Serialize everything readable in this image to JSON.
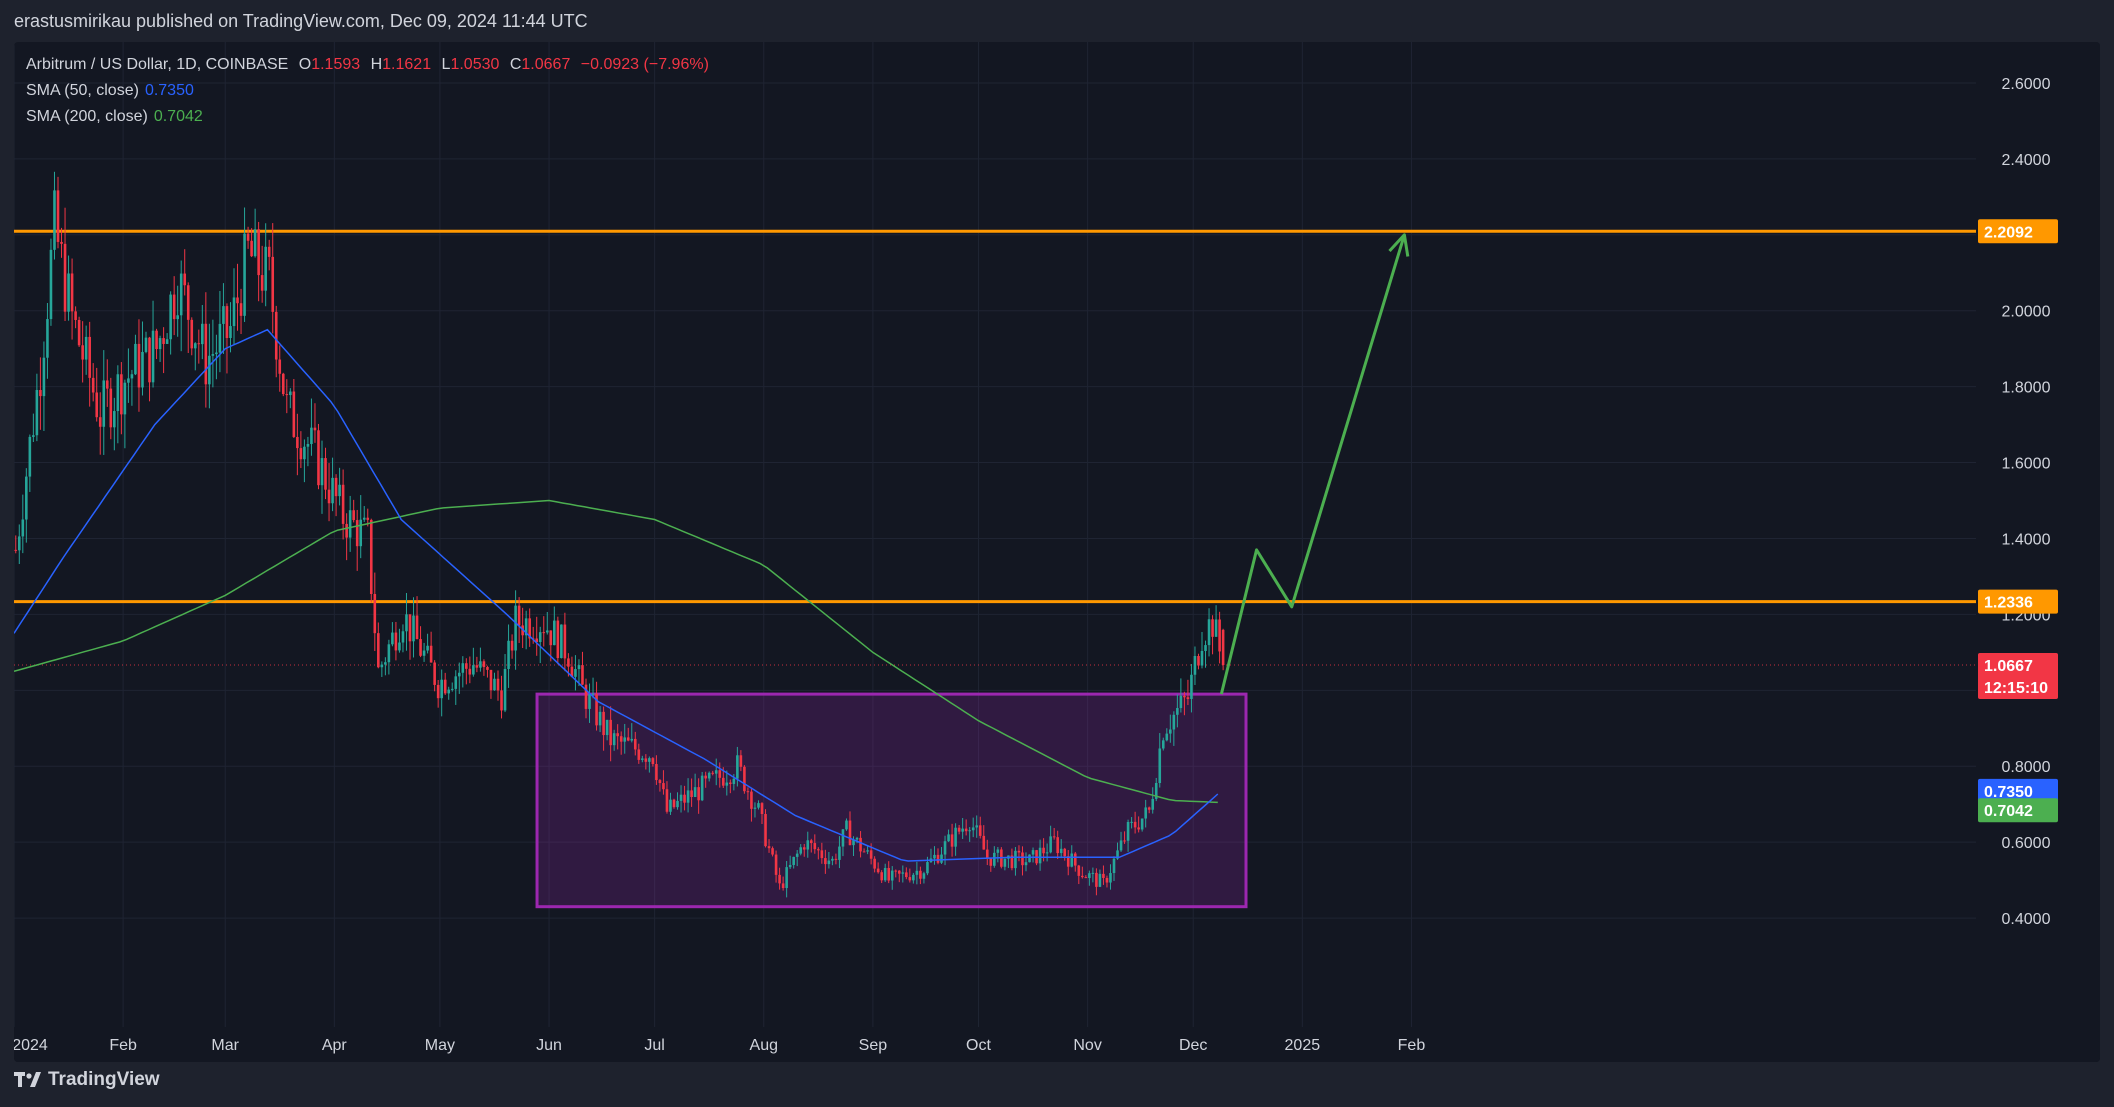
{
  "header": {
    "published": "erastusmirikau published on TradingView.com, Dec 09, 2024 11:44 UTC"
  },
  "legend": {
    "symbol": "Arbitrum / US Dollar, 1D, COINBASE",
    "o_label": "O",
    "o": "1.1593",
    "h_label": "H",
    "h": "1.1621",
    "l_label": "L",
    "l": "1.0530",
    "c_label": "C",
    "c": "1.0667",
    "change": "−0.0923 (−7.96%)",
    "sma50_label": "SMA (50, close)",
    "sma50": "0.7350",
    "sma200_label": "SMA (200, close)",
    "sma200": "0.7042"
  },
  "footer": {
    "brand": "TradingView"
  },
  "colors": {
    "up": "#26a69a",
    "down": "#f23645",
    "sma50": "#2962ff",
    "sma200": "#4caf50",
    "level": "#ff9800",
    "box": "#9c27b0",
    "projection": "#4caf50"
  },
  "chart_data": {
    "type": "candlestick",
    "ylim": [
      0.2,
      2.7
    ],
    "y_ticks": [
      "2.6000",
      "2.4000",
      "2.0000",
      "1.8000",
      "1.6000",
      "1.4000",
      "1.2000",
      "0.8000",
      "0.6000",
      "0.4000"
    ],
    "x_ticks": [
      "2024",
      "Feb",
      "Mar",
      "Apr",
      "May",
      "Jun",
      "Jul",
      "Aug",
      "Sep",
      "Oct",
      "Nov",
      "Dec",
      "2025",
      "Feb"
    ],
    "levels": [
      {
        "value": 2.2092,
        "label": "2.2092"
      },
      {
        "value": 1.2336,
        "label": "1.2336"
      }
    ],
    "last_price": {
      "value": 1.0667,
      "label": "1.0667",
      "countdown": "12:15:10"
    },
    "sma50_badge": {
      "value": 0.735,
      "label": "0.7350"
    },
    "sma200_badge": {
      "value": 0.7042,
      "label": "0.7042"
    },
    "consolidation_box": {
      "from": "2024-06-01",
      "to": "2024-12-16",
      "low": 0.43,
      "high": 0.99
    },
    "projection_path": [
      {
        "date": "2024-12-09",
        "value": 0.99
      },
      {
        "date": "2024-12-19",
        "value": 1.37
      },
      {
        "date": "2024-12-29",
        "value": 1.22
      },
      {
        "date": "2025-01-30",
        "value": 2.2
      }
    ],
    "price_anchors": [
      [
        "2024-01-01",
        1.37
      ],
      [
        "2024-01-08",
        1.85
      ],
      [
        "2024-01-12",
        2.22
      ],
      [
        "2024-01-17",
        1.98
      ],
      [
        "2024-01-25",
        1.73
      ],
      [
        "2024-02-01",
        1.82
      ],
      [
        "2024-02-10",
        1.9
      ],
      [
        "2024-02-16",
        2.08
      ],
      [
        "2024-02-24",
        1.87
      ],
      [
        "2024-03-02",
        1.95
      ],
      [
        "2024-03-07",
        2.15
      ],
      [
        "2024-03-13",
        2.08
      ],
      [
        "2024-03-18",
        1.74
      ],
      [
        "2024-03-26",
        1.62
      ],
      [
        "2024-04-03",
        1.46
      ],
      [
        "2024-04-10",
        1.4
      ],
      [
        "2024-04-13",
        1.05
      ],
      [
        "2024-04-20",
        1.2
      ],
      [
        "2024-04-30",
        1.02
      ],
      [
        "2024-05-10",
        1.07
      ],
      [
        "2024-05-18",
        0.99
      ],
      [
        "2024-05-22",
        1.18
      ],
      [
        "2024-05-30",
        1.18
      ],
      [
        "2024-06-06",
        1.1
      ],
      [
        "2024-06-10",
        1.0
      ],
      [
        "2024-06-18",
        0.87
      ],
      [
        "2024-06-30",
        0.83
      ],
      [
        "2024-07-04",
        0.68
      ],
      [
        "2024-07-10",
        0.72
      ],
      [
        "2024-07-24",
        0.8
      ],
      [
        "2024-07-30",
        0.68
      ],
      [
        "2024-08-05",
        0.48
      ],
      [
        "2024-08-12",
        0.6
      ],
      [
        "2024-08-20",
        0.55
      ],
      [
        "2024-08-24",
        0.63
      ],
      [
        "2024-09-05",
        0.5
      ],
      [
        "2024-09-15",
        0.53
      ],
      [
        "2024-09-22",
        0.6
      ],
      [
        "2024-09-28",
        0.66
      ],
      [
        "2024-10-03",
        0.56
      ],
      [
        "2024-10-15",
        0.55
      ],
      [
        "2024-10-22",
        0.6
      ],
      [
        "2024-10-30",
        0.52
      ],
      [
        "2024-11-05",
        0.49
      ],
      [
        "2024-11-12",
        0.63
      ],
      [
        "2024-11-18",
        0.68
      ],
      [
        "2024-11-22",
        0.9
      ],
      [
        "2024-11-29",
        0.98
      ],
      [
        "2024-12-03",
        1.15
      ],
      [
        "2024-12-06",
        1.18
      ],
      [
        "2024-12-09",
        1.0667
      ]
    ],
    "sma50_anchors": [
      [
        "2024-01-01",
        1.15
      ],
      [
        "2024-01-15",
        1.35
      ],
      [
        "2024-02-10",
        1.7
      ],
      [
        "2024-03-01",
        1.9
      ],
      [
        "2024-03-13",
        1.95
      ],
      [
        "2024-04-01",
        1.75
      ],
      [
        "2024-04-20",
        1.45
      ],
      [
        "2024-05-20",
        1.2
      ],
      [
        "2024-06-15",
        0.97
      ],
      [
        "2024-07-15",
        0.82
      ],
      [
        "2024-08-10",
        0.67
      ],
      [
        "2024-09-10",
        0.55
      ],
      [
        "2024-10-10",
        0.56
      ],
      [
        "2024-11-10",
        0.56
      ],
      [
        "2024-11-25",
        0.62
      ],
      [
        "2024-12-09",
        0.735
      ]
    ],
    "sma200_anchors": [
      [
        "2024-01-01",
        1.05
      ],
      [
        "2024-02-01",
        1.13
      ],
      [
        "2024-03-01",
        1.25
      ],
      [
        "2024-04-01",
        1.42
      ],
      [
        "2024-05-01",
        1.48
      ],
      [
        "2024-06-01",
        1.5
      ],
      [
        "2024-07-01",
        1.45
      ],
      [
        "2024-08-01",
        1.33
      ],
      [
        "2024-09-01",
        1.1
      ],
      [
        "2024-10-01",
        0.92
      ],
      [
        "2024-11-01",
        0.77
      ],
      [
        "2024-11-25",
        0.71
      ],
      [
        "2024-12-09",
        0.7042
      ]
    ]
  }
}
